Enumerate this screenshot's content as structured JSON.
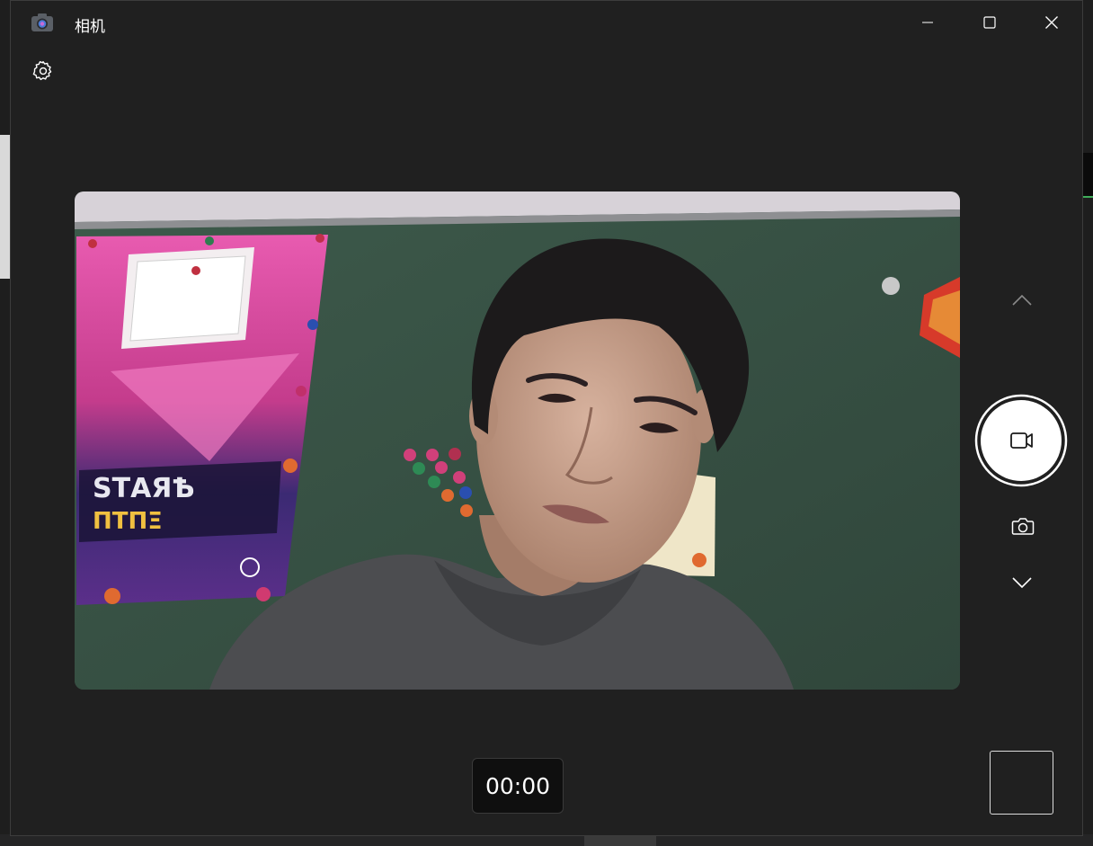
{
  "window": {
    "title": "相机",
    "controls": {
      "minimize": "minimize",
      "maximize": "maximize",
      "close": "close"
    }
  },
  "toolbar": {
    "settings_icon": "gear-icon"
  },
  "preview": {
    "description_icon": "camera-feed"
  },
  "capture_controls": {
    "mode_up_icon": "chevron-up-icon",
    "record_icon": "video-camera-icon",
    "photo_icon": "camera-icon",
    "mode_down_icon": "chevron-down-icon"
  },
  "recording": {
    "timer": "00:00"
  },
  "colors": {
    "window_bg": "#202020",
    "accent_white": "#ffffff"
  }
}
